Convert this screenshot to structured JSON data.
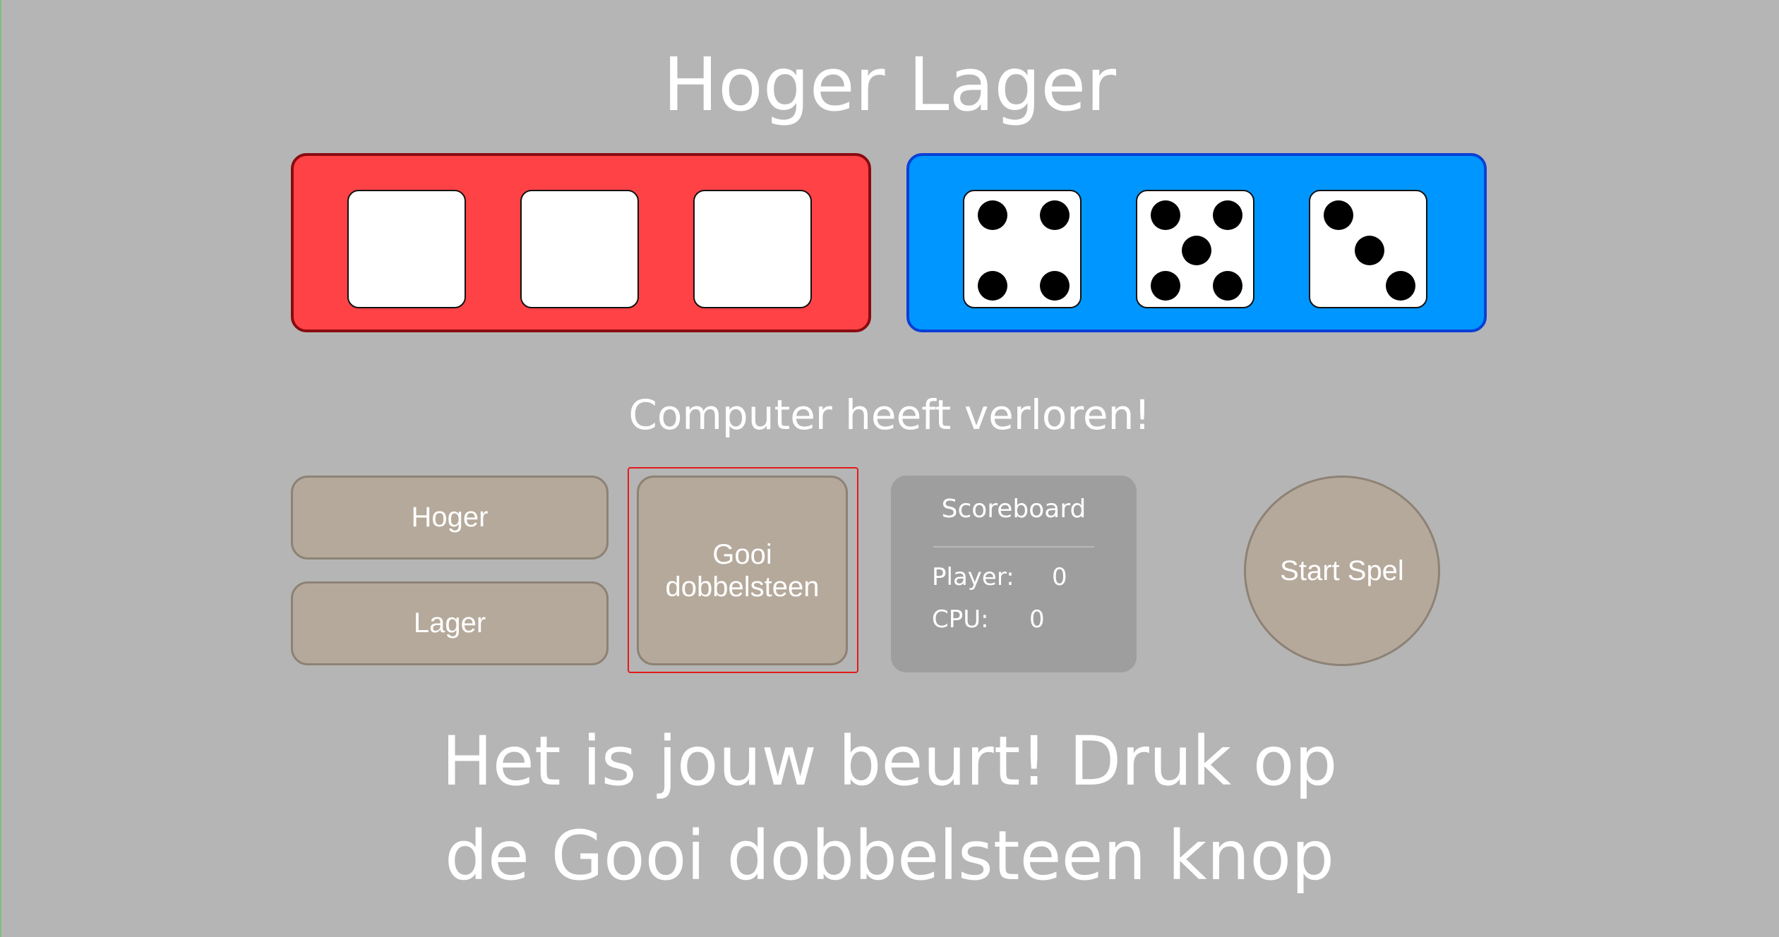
{
  "title": "Hoger Lager",
  "colors": {
    "background": "#b5b5b5",
    "player_panel": "#ff4245",
    "cpu_panel": "#0096ff",
    "button": "#b5a99b",
    "scoreboard": "#9e9e9e"
  },
  "player_dice": [
    null,
    null,
    null
  ],
  "cpu_dice": [
    4,
    5,
    3
  ],
  "result_message": "Computer heeft verloren!",
  "buttons": {
    "hoger": "Hoger",
    "lager": "Lager",
    "gooi": "Gooi dobbelsteen",
    "start": "Start Spel"
  },
  "scoreboard": {
    "title": "Scoreboard",
    "player_label": "Player:",
    "player_score": "0",
    "cpu_label": "CPU:",
    "cpu_score": "0"
  },
  "instruction_line1": "Het is jouw beurt! Druk op",
  "instruction_line2": "de Gooi dobbelsteen knop"
}
